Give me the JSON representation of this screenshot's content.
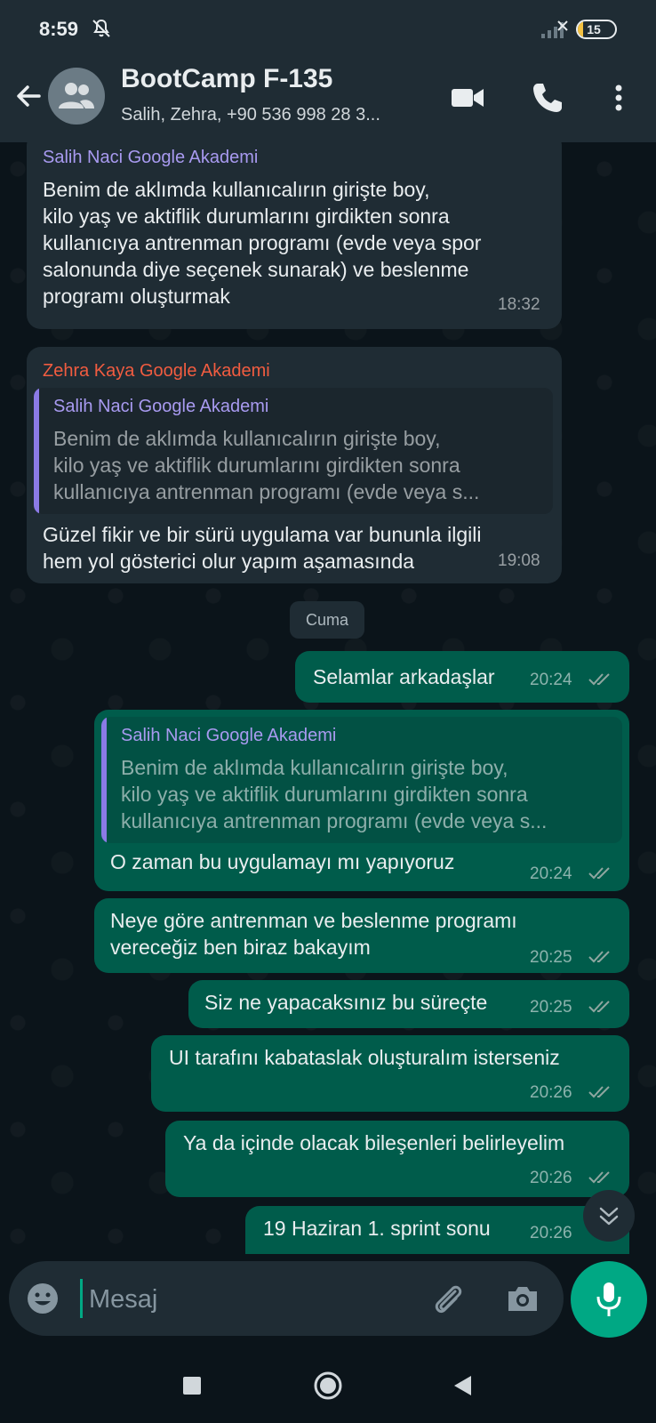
{
  "status_bar": {
    "time": "8:59",
    "battery": "15",
    "battery_level": 0.15
  },
  "header": {
    "title": "BootCamp F-135",
    "subtitle": "Salih, Zehra, +90 536 998 28 3..."
  },
  "messages": [
    {
      "sender": "Salih Naci Google Akademi",
      "text": "Benim de aklımda kullanıcalırın girişte boy,\nkilo yaş ve aktiflik durumlarını girdikten sonra\nkullanıcıya antrenman programı (evde veya spor\nsalonunda diye seçenek sunarak) ve beslenme\nprogramı oluşturmak",
      "time": "18:32"
    },
    {
      "sender": "Zehra Kaya Google Akademi",
      "quote_name": "Salih Naci Google Akademi",
      "quote_text": "Benim de aklımda kullanıcalırın girişte boy,\nkilo yaş ve aktiflik durumlarını girdikten sonra\nkullanıcıya antrenman programı (evde veya s...",
      "text": "Güzel fikir ve bir sürü uygulama var bununla ilgili\nhem yol gösterici olur yapım aşamasında",
      "time": "19:08"
    }
  ],
  "date_separator": "Cuma",
  "sent": [
    {
      "text": "Selamlar arkadaşlar",
      "time": "20:24"
    },
    {
      "quote_name": "Salih Naci Google Akademi",
      "quote_text": "Benim de aklımda kullanıcalırın girişte boy,\nkilo yaş ve aktiflik durumlarını girdikten sonra\nkullanıcıya antrenman programı (evde veya s...",
      "text": "O zaman bu uygulamayı mı yapıyoruz",
      "time": "20:24"
    },
    {
      "text": "Neye göre antrenman ve beslenme programı\nvereceğiz ben biraz bakayım",
      "time": "20:25"
    },
    {
      "text": "Siz ne yapacaksınız bu süreçte",
      "time": "20:25"
    },
    {
      "text": "UI tarafını kabataslak oluşturalım isterseniz",
      "time": "20:26"
    },
    {
      "text": "Ya da içinde olacak bileşenleri belirleyelim",
      "time": "20:26"
    },
    {
      "text": "19 Haziran 1. sprint sonu",
      "time": "20:26"
    }
  ],
  "input": {
    "placeholder": "Mesaj"
  },
  "colors": {
    "background": "#0b141a",
    "header": "#1f2c34",
    "incoming_bubble": "#1f2c34",
    "outgoing_bubble": "#005c4b",
    "accent": "#00a884",
    "sender_salih": "#a89af0",
    "sender_zehra": "#f15c40",
    "read_ticks": "#8fa6a0"
  },
  "icons": [
    "mute-icon",
    "back-arrow-icon",
    "group-avatar-icon",
    "video-call-icon",
    "phone-icon",
    "more-options-icon",
    "double-check-icon",
    "scroll-down-icon",
    "emoji-icon",
    "attach-icon",
    "camera-icon",
    "mic-icon",
    "nav-recents-icon",
    "nav-home-icon",
    "nav-back-icon"
  ]
}
